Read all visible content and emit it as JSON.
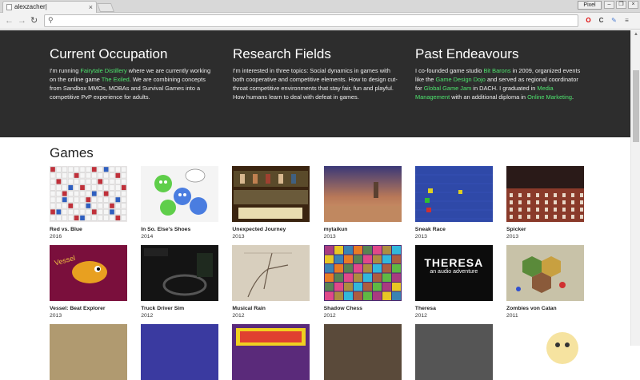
{
  "browser": {
    "tab_title": "alexzacher|",
    "tab_close": "×",
    "profile_label": "Pixel",
    "win_minimize": "–",
    "win_restore": "❐",
    "win_close": "×"
  },
  "sections": [
    {
      "title": "Current Occupation",
      "segments": [
        {
          "text": "I'm running ",
          "link": false
        },
        {
          "text": "Fairytale Distillery",
          "link": true
        },
        {
          "text": " where we are currently working on the online game ",
          "link": false
        },
        {
          "text": "The Exiled",
          "link": true
        },
        {
          "text": ". We are combining concepts from Sandbox MMOs, MOBAs and Survival Games into a competitive PvP experience for adults.",
          "link": false
        }
      ]
    },
    {
      "title": "Research Fields",
      "segments": [
        {
          "text": "I'm interested in three topics: Social dynamics in games with both cooperative and competitive elements. How to design cut-throat competitive environments that stay fair, fun and playful. How humans learn to deal with defeat in games.",
          "link": false
        }
      ]
    },
    {
      "title": "Past Endeavours",
      "segments": [
        {
          "text": "I co-founded game studio ",
          "link": false
        },
        {
          "text": "Bit Barons",
          "link": true
        },
        {
          "text": " in 2009, organized events like the ",
          "link": false
        },
        {
          "text": "Game Design Dojo",
          "link": true
        },
        {
          "text": " and served as regional coordinator for ",
          "link": false
        },
        {
          "text": "Global Game Jam",
          "link": true
        },
        {
          "text": " in DACH. I graduated in ",
          "link": false
        },
        {
          "text": "Media Management",
          "link": true
        },
        {
          "text": " with an additional diploma in ",
          "link": false
        },
        {
          "text": "Online Marketing",
          "link": true
        },
        {
          "text": ".",
          "link": false
        }
      ]
    }
  ],
  "games_heading": "Games",
  "games": [
    {
      "name": "Red vs. Blue",
      "year": "2016",
      "thumb": "grid",
      "bg": "#e9e6e6"
    },
    {
      "name": "In So. Else's Shoes",
      "year": "2014",
      "thumb": "blobs",
      "bg": "#f4f4f4"
    },
    {
      "name": "Unexpected Journey",
      "year": "2013",
      "thumb": "pixel",
      "bg": "#3a2410"
    },
    {
      "name": "mytaikun",
      "year": "2013",
      "thumb": "sky",
      "bg": "#5a3f5e"
    },
    {
      "name": "Sneak Race",
      "year": "2013",
      "thumb": "bluegrid",
      "bg": "#2f49a8"
    },
    {
      "name": "Spicker",
      "year": "2013",
      "thumb": "stage",
      "bg": "#7c3a2c"
    },
    {
      "name": "Vessel: Beat Explorer",
      "year": "2013",
      "thumb": "fish",
      "bg": "#7a0f3c"
    },
    {
      "name": "Truck Driver Sim",
      "year": "2012",
      "thumb": "dark",
      "bg": "#141414"
    },
    {
      "name": "Musical Rain",
      "year": "2012",
      "thumb": "paper",
      "bg": "#d8cfbe"
    },
    {
      "name": "Shadow Chess",
      "year": "2012",
      "thumb": "chess",
      "bg": "#4a2a70"
    },
    {
      "name": "Theresa",
      "year": "2012",
      "thumb": "theresa",
      "bg": "#0c0c0c",
      "headline": "THERESA",
      "subline": "an audio adventure"
    },
    {
      "name": "Zombies von Catan",
      "year": "2011",
      "thumb": "catan",
      "bg": "#c8c2a8"
    },
    {
      "name": "",
      "year": "",
      "thumb": "tan",
      "bg": "#b09a70"
    },
    {
      "name": "",
      "year": "",
      "thumb": "blue",
      "bg": "#3a3aa0"
    },
    {
      "name": "",
      "year": "",
      "thumb": "logo",
      "bg": "#5a2a7a"
    },
    {
      "name": "",
      "year": "",
      "thumb": "room",
      "bg": "#5a4a3a"
    },
    {
      "name": "",
      "year": "",
      "thumb": "grey",
      "bg": "#555"
    },
    {
      "name": "",
      "year": "",
      "thumb": "cartoon",
      "bg": "#f6e3a0"
    }
  ]
}
